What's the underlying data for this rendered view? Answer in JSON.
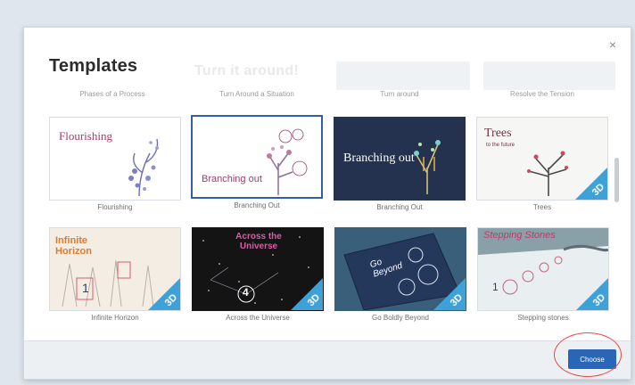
{
  "dialog": {
    "title": "Templates",
    "close_label": "×",
    "choose_label": "Choose",
    "ghost_header_text": "Turn it around!"
  },
  "previous_row_captions": [
    "Phases of a Process",
    "Turn Around a Situation",
    "Turn around",
    "Resolve the Tension"
  ],
  "templates": [
    {
      "caption": "Flourishing",
      "thumb_text": "Flourishing",
      "badge": ""
    },
    {
      "caption": "Branching Out",
      "thumb_text": "Branching out",
      "badge": ""
    },
    {
      "caption": "Branching Out",
      "thumb_text": "Branching out",
      "badge": ""
    },
    {
      "caption": "Trees",
      "thumb_text": "Trees",
      "thumb_subtext": "to the future",
      "badge": "3D"
    },
    {
      "caption": "Infinite Horizon",
      "thumb_text": "Infinite Horizon",
      "thumb_number": "1",
      "badge": "3D"
    },
    {
      "caption": "Across the Universe",
      "thumb_text": "Across the Universe",
      "thumb_number": "4",
      "badge": "3D"
    },
    {
      "caption": "Go Boldly Beyond",
      "thumb_text": "Go Beyond",
      "badge": "3D"
    },
    {
      "caption": "Stepping stones",
      "thumb_text": "Stepping Stones",
      "thumb_number": "1",
      "badge": "3D"
    }
  ],
  "colors": {
    "accent": "#2a66b8",
    "selected_border": "#2f5fa8",
    "badge": "#3ea2d9",
    "highlight": "#e44a4a"
  }
}
